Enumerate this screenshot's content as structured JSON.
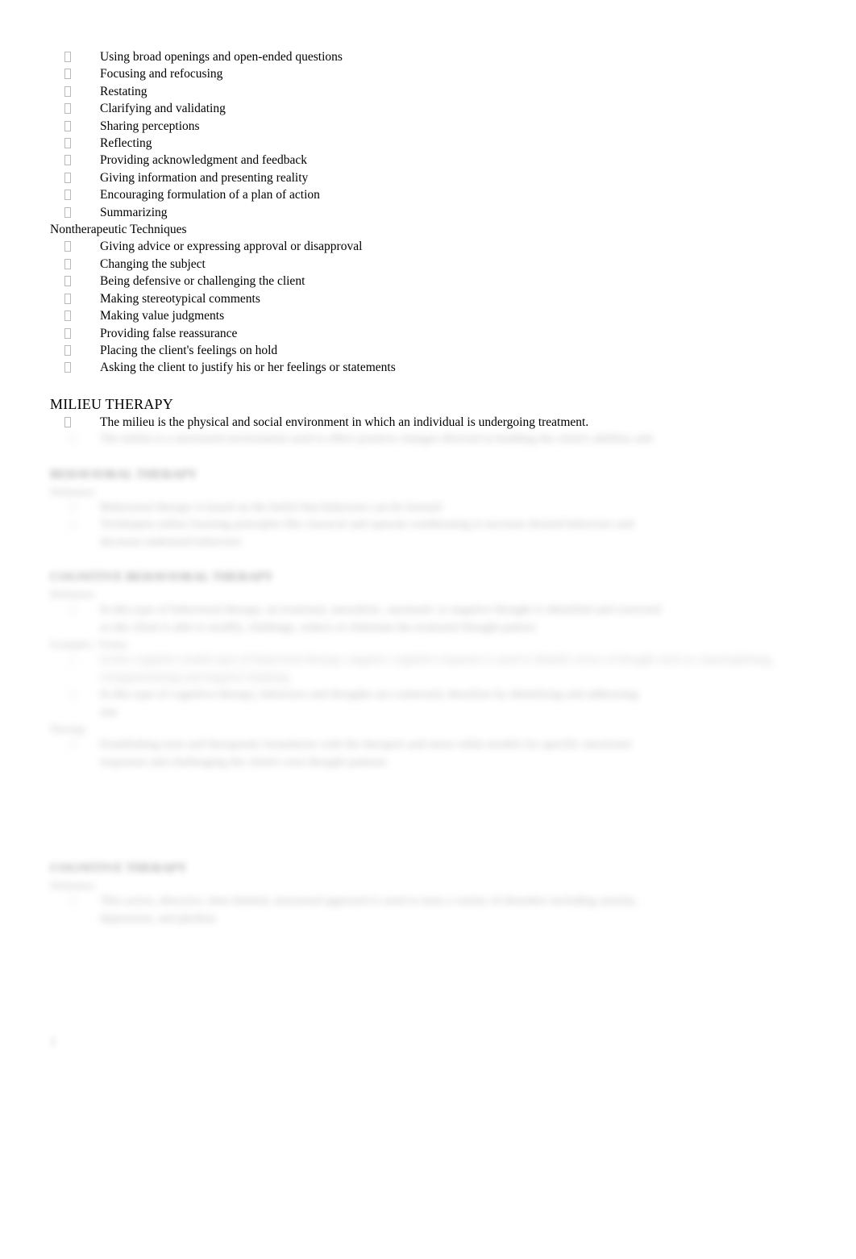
{
  "document": {
    "background_color": "#ffffff",
    "text_color": "#000000",
    "bullet_glyph": "□"
  },
  "therapeutic_techniques": {
    "items": [
      "Using broad openings and open-ended questions",
      "Focusing and refocusing",
      "Restating",
      "Clarifying and validating",
      "Sharing perceptions",
      "Reflecting",
      "Providing acknowledgment and feedback",
      "Giving information and presenting reality",
      "Encouraging formulation of a plan of action",
      "Summarizing"
    ]
  },
  "nontherapeutic_techniques": {
    "heading": "Nontherapeutic Techniques",
    "items": [
      "Giving advice or expressing approval or disapproval",
      "Changing the subject",
      "Being defensive or challenging the client",
      "Making stereotypical comments",
      "Making value judgments",
      "Providing false reassurance",
      "Placing the client's feelings on hold",
      "Asking the client to justify his or her feelings or statements"
    ]
  },
  "milieu_therapy": {
    "heading": "MILIEU THERAPY",
    "items": [
      "The milieu is the physical and social environment in which an individual is undergoing treatment.",
      "The milieu is a structured environment used to effect positive changes directed at building the client's abilities and"
    ]
  },
  "behavioral_therapy": {
    "heading": "BEHAVIORAL THERAPY",
    "label": "Definition:",
    "items": [
      "Behavioral therapy is based on the belief that behaviors can be learned",
      "Techniques utilize learning principles like classical and operant conditioning to increase desired behaviors and decrease undesired behaviors"
    ]
  },
  "cognitive_behavioral_therapy": {
    "heading": "COGNITIVE BEHAVIORAL THERAPY",
    "label_definition": "Definition:",
    "definition_items": [
      "In this type of behavioral therapy, an irrational, unrealistic, automatic or negative thought is identified and corrected so the client is able to modify, challenge, reduce or eliminate the irrational thought pattern"
    ],
    "label_examples": "Examples / Forms:",
    "example_items": [
      "In this cognitive model type of behavioral therapy, negative cognitive response is used to identify errors of thought such as catastrophizing, overgeneralizing and negative thinking",
      "In this type of cognitive therapy, behaviors and thoughts are connected, therefore by identifying and addressing one"
    ],
    "label_nursing": "Nursing:",
    "nursing_items": [
      "Establishing trust and therapeutic boundaries with the therapist and nurse while models for specific emotional responses and challenging the client's own thought patterns"
    ]
  },
  "cognitive_therapy": {
    "heading": "COGNITIVE THERAPY",
    "label": "Definition:",
    "items": [
      "This active, directive, time-limited, structured approach is used to treat a variety of disorders including anxiety, depression, and phobias"
    ]
  },
  "page_marker": "2"
}
